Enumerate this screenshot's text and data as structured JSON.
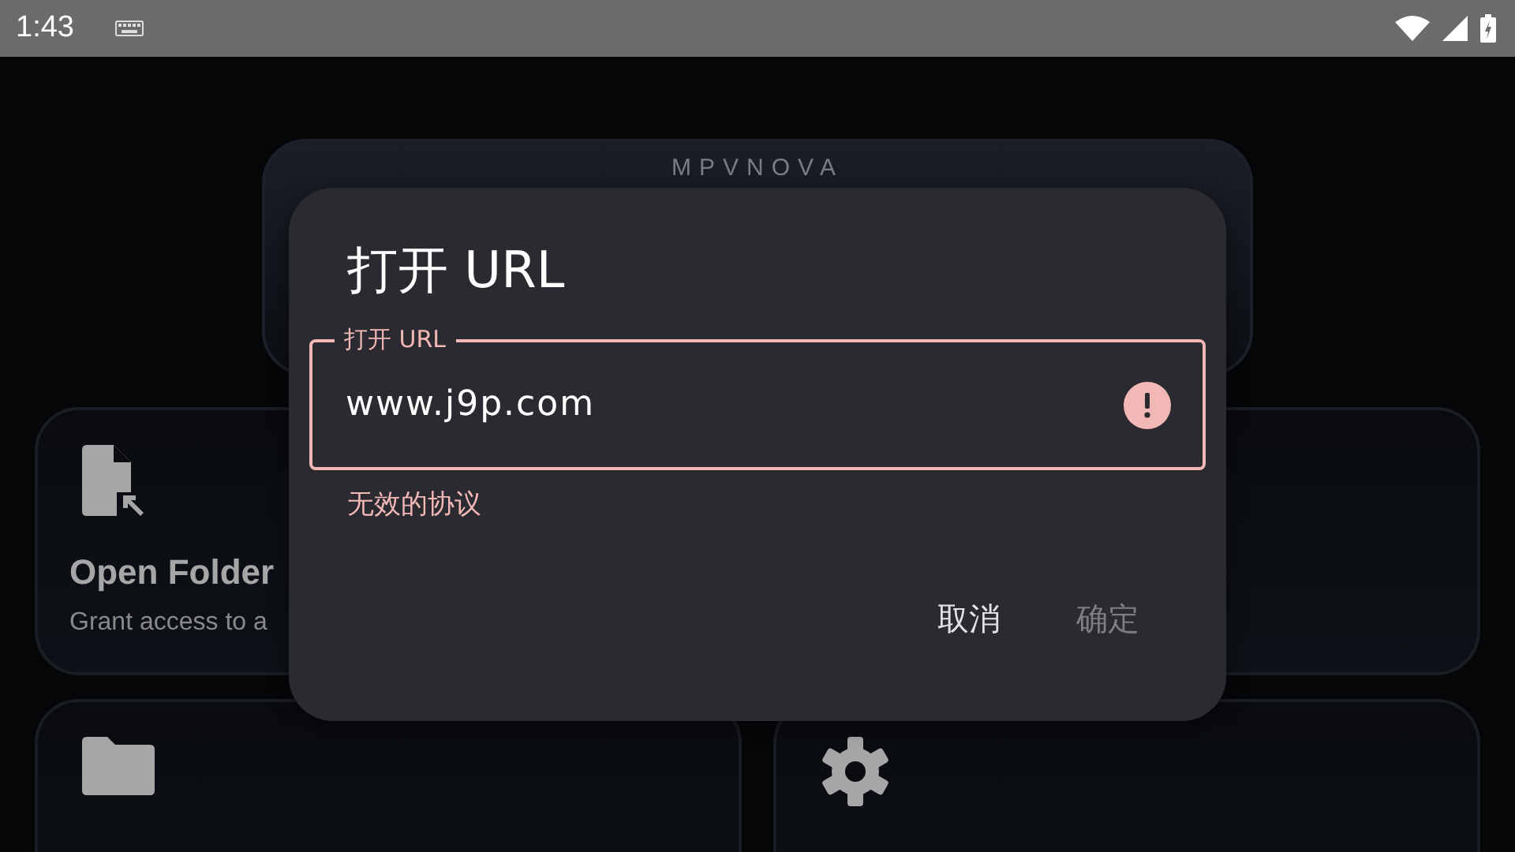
{
  "status_bar": {
    "time": "1:43"
  },
  "header_card": {
    "title": "MPVNOVA"
  },
  "cards": [
    {
      "kind": "file",
      "title": "Open Folder",
      "subtitle": "Grant access to a"
    },
    {
      "kind": "blank"
    },
    {
      "kind": "folder"
    },
    {
      "kind": "settings"
    }
  ],
  "dialog": {
    "title": "打开 URL",
    "field": {
      "label": "打开 URL",
      "value": "www.j9p.com",
      "error": true,
      "helper": "无效的协议"
    },
    "buttons": [
      {
        "label": "取消",
        "disabled": false
      },
      {
        "label": "确定",
        "disabled": true
      }
    ]
  }
}
